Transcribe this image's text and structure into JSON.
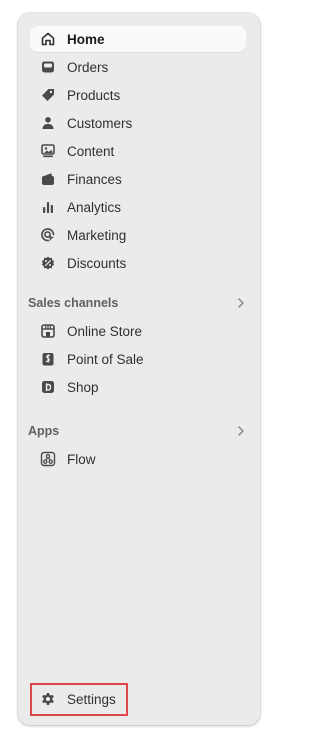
{
  "main_nav": [
    {
      "label": "Home",
      "icon": "home-icon",
      "active": true
    },
    {
      "label": "Orders",
      "icon": "inbox-icon"
    },
    {
      "label": "Products",
      "icon": "tag-icon"
    },
    {
      "label": "Customers",
      "icon": "person-icon"
    },
    {
      "label": "Content",
      "icon": "image-document-icon"
    },
    {
      "label": "Finances",
      "icon": "wallet-icon"
    },
    {
      "label": "Analytics",
      "icon": "bar-chart-icon"
    },
    {
      "label": "Marketing",
      "icon": "target-icon"
    },
    {
      "label": "Discounts",
      "icon": "discount-badge-icon"
    }
  ],
  "sales_channels": {
    "title": "Sales channels",
    "items": [
      {
        "label": "Online Store",
        "icon": "storefront-icon"
      },
      {
        "label": "Point of Sale",
        "icon": "pos-bag-icon"
      },
      {
        "label": "Shop",
        "icon": "shop-icon"
      }
    ]
  },
  "apps": {
    "title": "Apps",
    "items": [
      {
        "label": "Flow",
        "icon": "flow-icon"
      }
    ]
  },
  "settings": {
    "label": "Settings",
    "icon": "gear-icon"
  },
  "colors": {
    "panel_background": "#ebebeb",
    "active_item_background": "#fafafa",
    "highlight_border": "#e0474c"
  }
}
